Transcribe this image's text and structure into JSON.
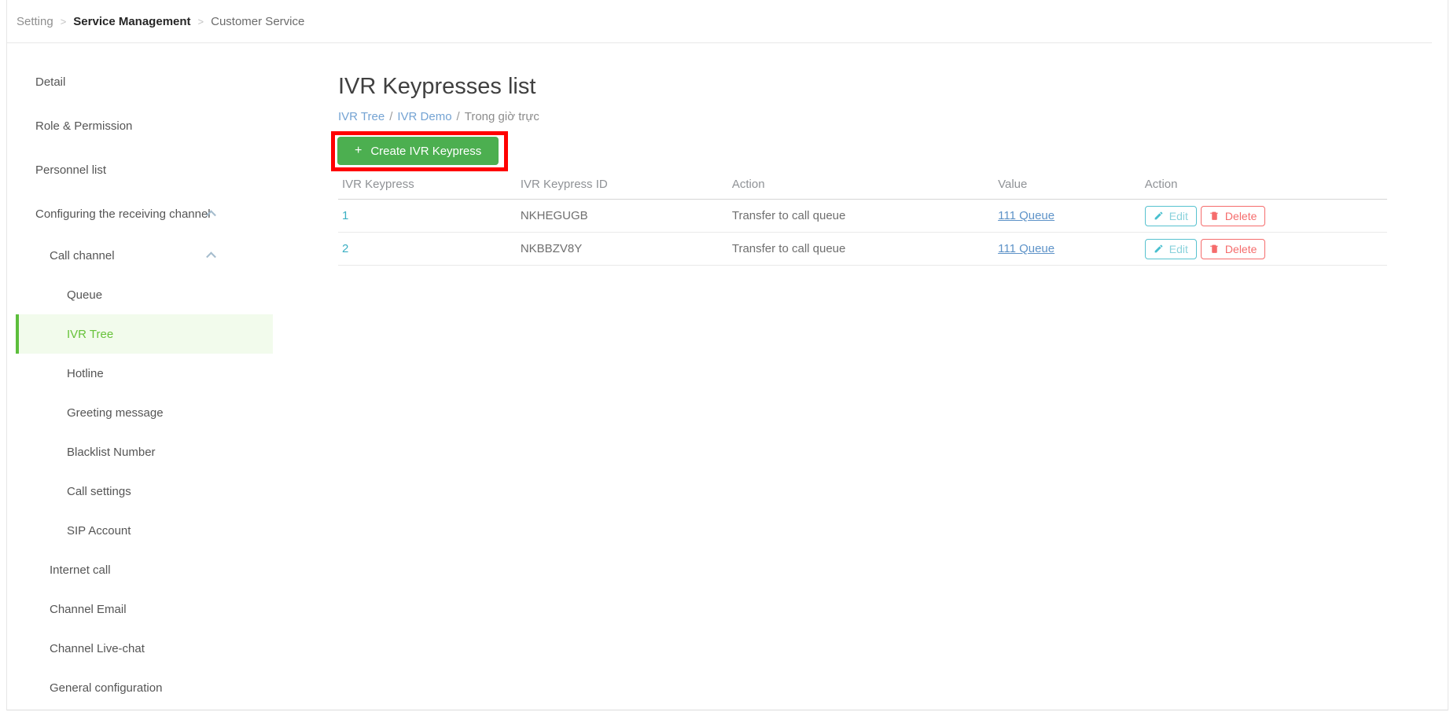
{
  "top_breadcrumb": {
    "separator": ">",
    "items": [
      {
        "label": "Setting"
      },
      {
        "label": "Service Management"
      },
      {
        "label": "Customer Service"
      }
    ]
  },
  "sidebar": {
    "items": [
      {
        "label": "Detail",
        "level": 1
      },
      {
        "label": "Role & Permission",
        "level": 1
      },
      {
        "label": "Personnel list",
        "level": 1
      },
      {
        "label": "Configuring the receiving channel",
        "level": 1,
        "expandable": true,
        "expanded": true
      },
      {
        "label": "Call channel",
        "level": 2,
        "expandable": true,
        "expanded": true
      },
      {
        "label": "Queue",
        "level": 3
      },
      {
        "label": "IVR Tree",
        "level": 3,
        "active": true
      },
      {
        "label": "Hotline",
        "level": 3
      },
      {
        "label": "Greeting message",
        "level": 3
      },
      {
        "label": "Blacklist Number",
        "level": 3
      },
      {
        "label": "Call settings",
        "level": 3
      },
      {
        "label": "SIP Account",
        "level": 3
      },
      {
        "label": "Internet call",
        "level": 2
      },
      {
        "label": "Channel Email",
        "level": 2
      },
      {
        "label": "Channel Live-chat",
        "level": 2
      },
      {
        "label": "General configuration",
        "level": 2
      }
    ]
  },
  "main": {
    "title": "IVR Keypresses list",
    "breadcrumb": {
      "separator": "/",
      "link1": "IVR Tree",
      "link2": "IVR Demo",
      "current": "Trong giờ trực"
    },
    "create_button": {
      "plus": "+",
      "label": "Create IVR Keypress"
    },
    "table": {
      "columns": [
        "IVR Keypress",
        "IVR Keypress ID",
        "Action",
        "Value",
        "Action"
      ],
      "rows": [
        {
          "keypress": "1",
          "id": "NKHEGUGB",
          "action": "Transfer to call queue",
          "value": "111 Queue",
          "edit_label": "Edit",
          "delete_label": "Delete"
        },
        {
          "keypress": "2",
          "id": "NKBBZV8Y",
          "action": "Transfer to call queue",
          "value": "111 Queue",
          "edit_label": "Edit",
          "delete_label": "Delete"
        }
      ]
    }
  },
  "colors": {
    "button_green": "#4caf50",
    "annotation_red": "#ff0000",
    "active_item_green": "#67c23a",
    "active_item_bg": "#f2fbec",
    "edit_teal": "#57c2cf",
    "delete_red": "#f56c6c",
    "row_link_teal": "#3aafc3",
    "value_link_blue": "#5e93c8",
    "breadcrumb_link_blue": "#74a3d3"
  }
}
